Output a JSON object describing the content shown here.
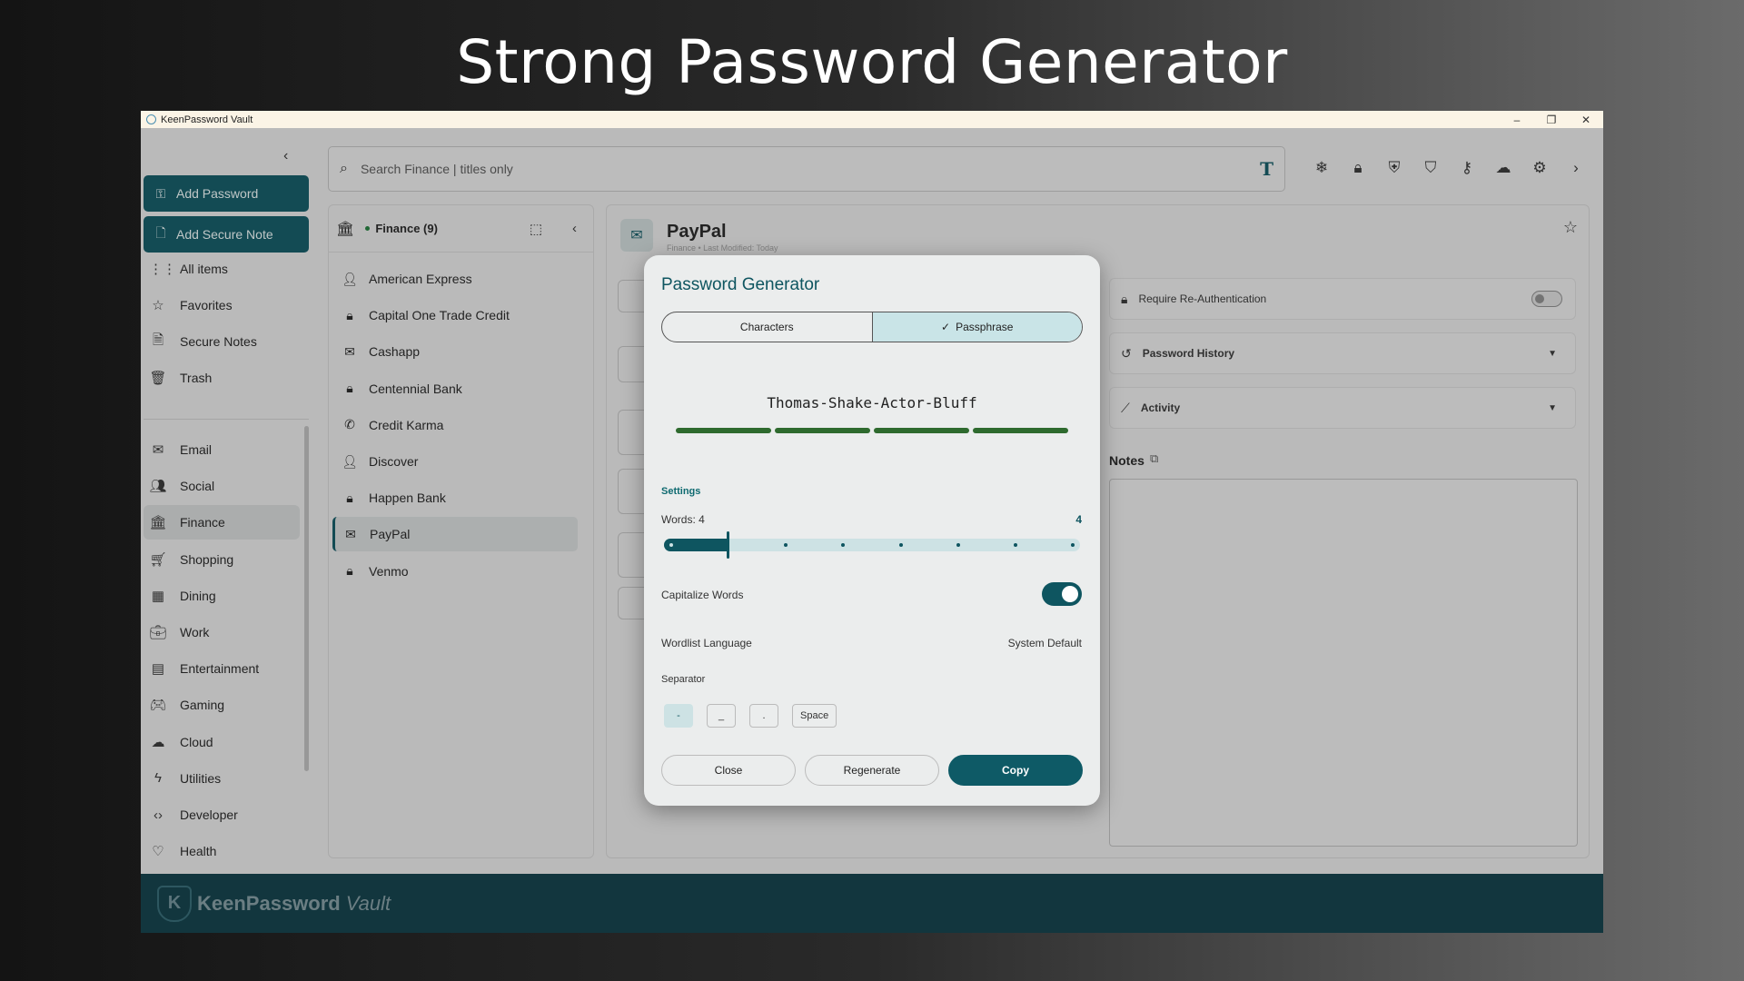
{
  "hero": {
    "title": "Strong Password Generator"
  },
  "window": {
    "title": "KeenPassword Vault",
    "controls": [
      "–",
      "❐",
      "✕"
    ]
  },
  "sidebar": {
    "add_password": "Add Password",
    "add_secure_note": "Add Secure Note",
    "items_top": [
      {
        "label": "All items",
        "icon": "grid-icon"
      },
      {
        "label": "Favorites",
        "icon": "star-icon"
      },
      {
        "label": "Secure Notes",
        "icon": "note-icon"
      },
      {
        "label": "Trash",
        "icon": "trash-icon"
      }
    ],
    "items_categories": [
      {
        "label": "Email",
        "icon": "mail-icon"
      },
      {
        "label": "Social",
        "icon": "people-icon"
      },
      {
        "label": "Finance",
        "icon": "bank-icon",
        "active": true
      },
      {
        "label": "Shopping",
        "icon": "cart-icon"
      },
      {
        "label": "Dining",
        "icon": "calculator-icon"
      },
      {
        "label": "Work",
        "icon": "briefcase-icon"
      },
      {
        "label": "Entertainment",
        "icon": "calendar-icon"
      },
      {
        "label": "Gaming",
        "icon": "gamepad-icon"
      },
      {
        "label": "Cloud",
        "icon": "cloud-icon"
      },
      {
        "label": "Utilities",
        "icon": "bolt-icon"
      },
      {
        "label": "Developer",
        "icon": "code-icon"
      },
      {
        "label": "Health",
        "icon": "heart-icon"
      }
    ]
  },
  "search": {
    "placeholder": "Search Finance | titles only"
  },
  "list": {
    "header": "Finance (9)",
    "items": [
      {
        "label": "American Express",
        "icon": "person-icon"
      },
      {
        "label": "Capital One Trade Credit",
        "icon": "lock-icon"
      },
      {
        "label": "Cashapp",
        "icon": "mail-icon"
      },
      {
        "label": "Centennial Bank",
        "icon": "lock-icon"
      },
      {
        "label": "Credit Karma",
        "icon": "phone-icon"
      },
      {
        "label": "Discover",
        "icon": "person-icon"
      },
      {
        "label": "Happen Bank",
        "icon": "lock-icon"
      },
      {
        "label": "PayPal",
        "icon": "mail-icon",
        "active": true
      },
      {
        "label": "Venmo",
        "icon": "lock-icon"
      }
    ]
  },
  "detail": {
    "title": "PayPal",
    "subtitle": "Finance • Last Modified: Today",
    "require_reauth": "Require Re-Authentication",
    "password_history": "Password History",
    "activity": "Activity",
    "notes": "Notes"
  },
  "footer": {
    "brand": "KeenPassword",
    "brand_suffix": "Vault"
  },
  "generator": {
    "title": "Password Generator",
    "tab_characters": "Characters",
    "tab_passphrase": "Passphrase",
    "selected_tab": "Passphrase",
    "password": "Thomas-Shake-Actor-Bluff",
    "strength_segments": 4,
    "settings_label": "Settings",
    "words_label": "Words: 4",
    "words_value": "4",
    "words_slider": {
      "min": 3,
      "max": 10,
      "value": 4
    },
    "capitalize_label": "Capitalize Words",
    "capitalize_on": true,
    "wordlist_label": "Wordlist Language",
    "wordlist_value": "System Default",
    "separator_label": "Separator",
    "separators": [
      "-",
      "_",
      ".",
      "Space"
    ],
    "selected_separator": "-",
    "close": "Close",
    "regenerate": "Regenerate",
    "copy": "Copy"
  },
  "colors": {
    "accent": "#0e5560",
    "strength": "#2e6a2e",
    "footer": "#0c3a44"
  }
}
